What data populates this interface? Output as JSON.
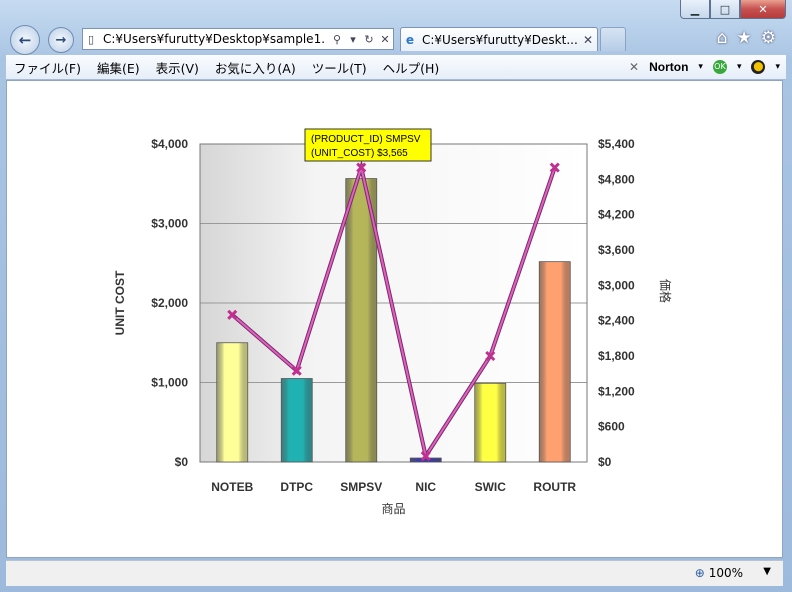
{
  "window": {
    "address_text": "C:¥Users¥furutty¥Desktop¥sample1.",
    "tab_title": "C:¥Users¥furutty¥Deskt...",
    "min_label": "▁",
    "max_label": "□",
    "close_label": "✕"
  },
  "menu": {
    "items": [
      "ファイル(F)",
      "編集(E)",
      "表示(V)",
      "お気に入り(A)",
      "ツール(T)",
      "ヘルプ(H)"
    ],
    "norton_label": "Norton",
    "norton_close": "✕"
  },
  "status": {
    "zoom": "100%"
  },
  "tooltip": {
    "line1": "(PRODUCT_ID) SMPSV",
    "line2": "(UNIT_COST) $3,565"
  },
  "chart_data": {
    "type": "bar+line",
    "categories": [
      "NOTEB",
      "DTPC",
      "SMPSV",
      "NIC",
      "SWIC",
      "ROUTR"
    ],
    "xlabel": "商品",
    "ylabel": "UNIT COST",
    "y2label": "価格",
    "ylim": [
      0,
      4000
    ],
    "yticks": [
      "$0",
      "$1,000",
      "$2,000",
      "$3,000",
      "$4,000"
    ],
    "y2lim": [
      0,
      5400
    ],
    "y2ticks": [
      "$0",
      "$600",
      "$1,200",
      "$1,800",
      "$2,400",
      "$3,000",
      "$3,600",
      "$4,200",
      "$4,800",
      "$5,400"
    ],
    "bars": {
      "values": [
        1500,
        1050,
        3565,
        50,
        990,
        2520
      ],
      "colors": [
        "#ffff99",
        "#20b2b2",
        "#b5b55a",
        "#3a3ab0",
        "#ffff44",
        "#ffa070"
      ]
    },
    "line": {
      "values": [
        2500,
        1550,
        5000,
        100,
        1800,
        5000
      ],
      "color": "#e060c0"
    },
    "grid": true
  }
}
